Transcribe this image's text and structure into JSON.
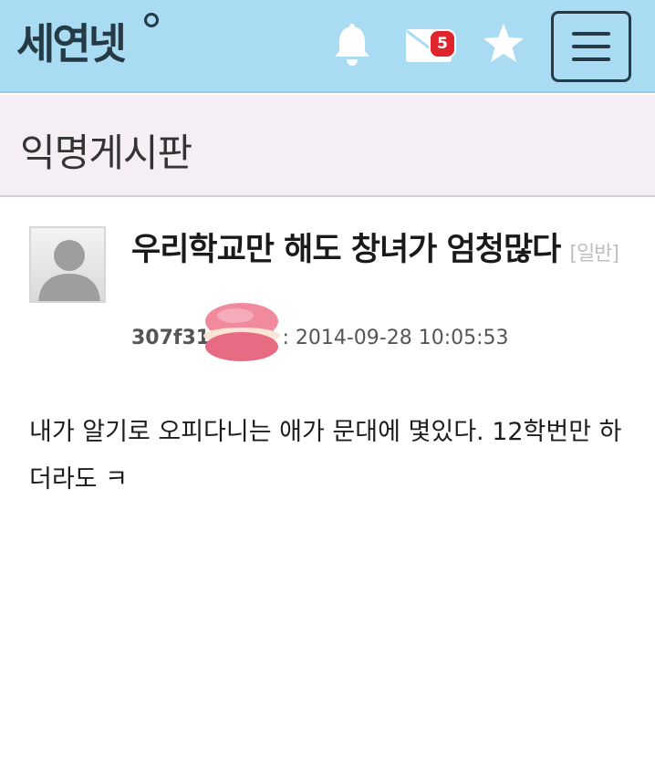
{
  "header": {
    "logo_text": "세연넷",
    "mail_badge_count": "5",
    "icons": [
      "bell-icon",
      "mail-icon",
      "star-icon",
      "hamburger-menu-icon"
    ],
    "colors": {
      "topbar": "#a9dcf3",
      "badge": "#e0242b",
      "board_header": "#f5eff5"
    }
  },
  "board": {
    "title": "익명게시판"
  },
  "post": {
    "title": "우리학교만 해도 창녀가 엄청많다",
    "category": "[일반]",
    "author": "307f311f",
    "meta_label": "작성 : 2014-09-28 10:05:53",
    "body": "내가 알기로 오피다니는 애가 문대에 몇있다. 12학번만 하더라도 ㅋ"
  }
}
